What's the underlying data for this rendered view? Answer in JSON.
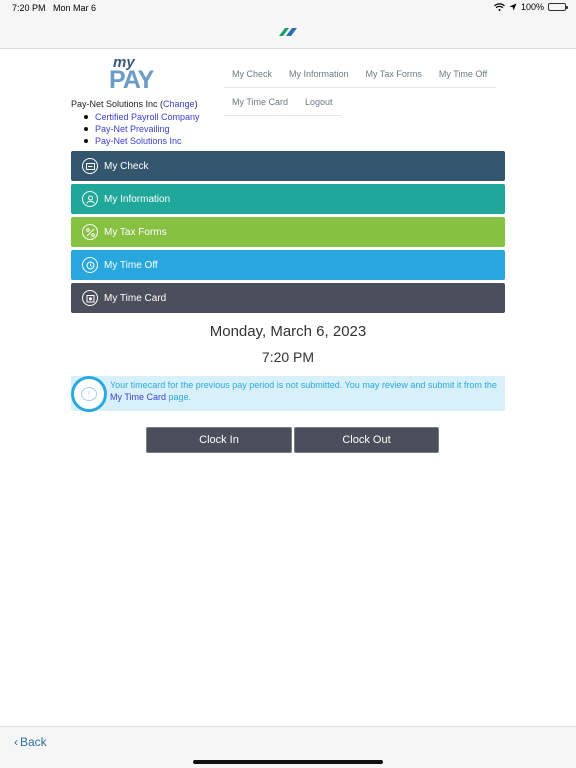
{
  "status_bar": {
    "time": "7:20 PM",
    "date": "Mon Mar 6",
    "battery": "100%",
    "icons": [
      "wifi-icon",
      "location-icon",
      "battery-icon"
    ]
  },
  "top_bar": {
    "logo_icon": "paynet-logo-icon"
  },
  "header": {
    "logo_my": "my",
    "logo_pay": "PAY",
    "nav": {
      "row1": [
        "My Check",
        "My Information",
        "My Tax Forms",
        "My Time Off"
      ],
      "row2": [
        "My Time Card",
        "Logout"
      ]
    }
  },
  "company": {
    "name": "Pay-Net Solutions Inc",
    "open_paren": " (",
    "change_label": "Change",
    "close_paren": ")",
    "list": [
      "Certified Payroll Company",
      "Pay-Net Prevailing",
      "Pay-Net Solutions Inc"
    ]
  },
  "menu": [
    {
      "label": "My Check",
      "icon": "check-icon",
      "color": "#34556e"
    },
    {
      "label": "My Information",
      "icon": "person-icon",
      "color": "#1fa79a"
    },
    {
      "label": "My Tax Forms",
      "icon": "percent-icon",
      "color": "#86c142"
    },
    {
      "label": "My Time Off",
      "icon": "clock-icon",
      "color": "#27a7de"
    },
    {
      "label": "My Time Card",
      "icon": "timecard-icon",
      "color": "#4b4f5b"
    }
  ],
  "date_display": "Monday, March 6, 2023",
  "time_display": "7:20 PM",
  "alert": {
    "icon": "message-bubble-icon",
    "icon_glyph": "!",
    "text_part1": "Your timecard for the previous pay period is not submitted. You may review and submit it from the ",
    "link_text": "My Time Card",
    "text_part2": " page."
  },
  "buttons": {
    "clock_in": "Clock In",
    "clock_out": "Clock Out"
  },
  "bottom": {
    "back_chevron": "‹",
    "back_label": "Back"
  }
}
